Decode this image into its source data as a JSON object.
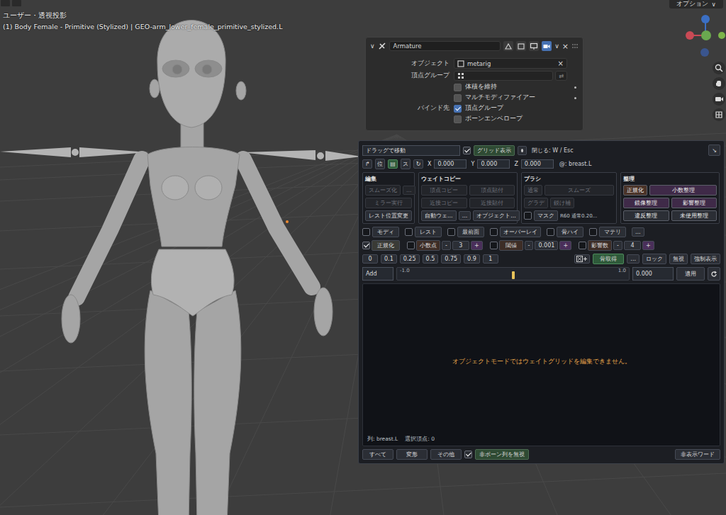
{
  "viewport": {
    "mode": "ユーザー・透視投影",
    "object": "(1) Body Female - Primitive (Stylized) | GEO-arm_lower_female_primitive_stylized.L",
    "options": "オプション",
    "options_arrow": "∨",
    "gizmo": [
      {
        "color": "#c94a55"
      },
      {
        "color": "#6aa84f"
      },
      {
        "color": "#7cb54a"
      },
      {
        "color": "#3b6fc4"
      },
      {
        "color": "#3a558e"
      }
    ]
  },
  "modifier": {
    "collapse": "∨",
    "name": "Armature",
    "toggles": [
      {
        "selected": false
      },
      {
        "selected": false
      },
      {
        "selected": false
      },
      {
        "selected": true
      }
    ],
    "dropdown": "∨",
    "close": "×",
    "object": {
      "label": "オブジェクト",
      "value": "metarig",
      "clear": "×"
    },
    "vgroup": {
      "label": "頂点グループ",
      "swap": "⇄"
    },
    "checks": [
      {
        "label": "体積を維持",
        "checked": false
      },
      {
        "label": "マルチモディファイアー",
        "checked": false
      }
    ],
    "bind_label": "バインド先",
    "bind": [
      {
        "label": "頂点グループ",
        "checked": true
      },
      {
        "label": "ボーンエンベロープ",
        "checked": false
      }
    ]
  },
  "weight": {
    "drag": "ドラッグで移動",
    "grid": {
      "label": "グリッド表示",
      "checked": true
    },
    "close_hint": "閉じる: W / Esc",
    "corner": "↘",
    "tools": [
      {
        "label": "↱",
        "selected": false
      },
      {
        "label": "位",
        "selected": false
      },
      {
        "label": "▤",
        "selected": true
      },
      {
        "label": "ス",
        "selected": false
      },
      {
        "label": "↻",
        "selected": false
      }
    ],
    "coords": [
      {
        "axis": "X",
        "value": "0.000"
      },
      {
        "axis": "Y",
        "value": "0.000"
      },
      {
        "axis": "Z",
        "value": "0.000"
      }
    ],
    "active": "@: breast.L",
    "groups": [
      {
        "title": "編集",
        "rows": [
          [
            {
              "label": "スムーズ化",
              "disabled": true
            },
            {
              "label": "...",
              "disabled": true
            }
          ],
          [
            {
              "label": "ミラー実行",
              "disabled": true
            }
          ],
          [
            {
              "label": "レスト位置変更",
              "disabled": false
            }
          ]
        ]
      },
      {
        "title": "ウェイトコピー",
        "rows": [
          [
            {
              "label": "頂点コピー",
              "disabled": true
            },
            {
              "label": "頂点貼付",
              "disabled": true
            }
          ],
          [
            {
              "label": "近接コピー",
              "disabled": true
            },
            {
              "label": "近接貼付",
              "disabled": true
            }
          ],
          [
            {
              "label": "自動ウェ...",
              "disabled": false
            },
            {
              "label": "...",
              "disabled": false
            },
            {
              "label": "オブジェクト...",
              "disabled": false
            }
          ]
        ]
      },
      {
        "title": "ブラシ",
        "rows": [
          [
            {
              "label": "通常",
              "disabled": true
            },
            {
              "label": "スムーズ",
              "disabled": true
            }
          ],
          [
            {
              "label": "グラデ",
              "disabled": true
            },
            {
              "label": "鋭け補",
              "disabled": true
            }
          ]
        ]
      },
      {
        "title": "整理",
        "rows": [
          [
            {
              "label": "正規化",
              "color": "#4a3328"
            },
            {
              "label": "小数整理",
              "color": "#3f2a48"
            }
          ],
          [
            {
              "label": "鏡像整理",
              "color": "#3f2a48"
            },
            {
              "label": "影響整理",
              "color": "#3f2a48"
            }
          ],
          [
            {
              "label": "違反整理",
              "color": "#2b2e35"
            },
            {
              "label": "未使用整理",
              "color": "#2b2e35"
            }
          ]
        ]
      }
    ],
    "mask": {
      "label": "マスク",
      "checked": false
    },
    "brush_info": "R60 通常0.20...",
    "toggles": [
      {
        "label": "モディ",
        "checked": false
      },
      {
        "label": "レスト",
        "checked": false
      },
      {
        "label": "最前面",
        "checked": false
      },
      {
        "label": "オーバーレイ",
        "checked": false
      },
      {
        "label": "骨ハイ",
        "checked": false
      },
      {
        "label": "マテリ",
        "checked": false
      }
    ],
    "toggles_more": "...",
    "options": [
      {
        "kind": "check",
        "label": "正規化",
        "checked": true
      },
      {
        "kind": "stepper",
        "label": "小数点",
        "checked": false,
        "minus": "-",
        "value": "3",
        "plus": "+"
      },
      {
        "kind": "stepper",
        "label": "閾値",
        "checked": false,
        "minus": "-",
        "value": "0.001",
        "plus": "+"
      },
      {
        "kind": "stepper",
        "label": "影響数",
        "checked": false,
        "minus": "-",
        "value": "4",
        "plus": "+"
      }
    ],
    "presets": [
      "0",
      "0.1",
      "0.25",
      "0.5",
      "0.75",
      "0.9",
      "1"
    ],
    "bone_buttons": [
      {
        "label": "骨取得",
        "selected": true
      },
      {
        "label": "...",
        "selected": false
      },
      {
        "label": "ロック",
        "selected": false
      },
      {
        "label": "無視",
        "selected": false
      },
      {
        "label": "強制表示",
        "selected": false
      }
    ],
    "slider": {
      "mode": "Add",
      "min": "-1.0",
      "max": "1.0",
      "level": 0.5,
      "value": "0.000",
      "apply": "適用"
    },
    "message": "オブジェクトモードではウェイトグリッドを編集できません。",
    "status": {
      "column": "列: breast.L",
      "selected": "選択頂点: 0"
    },
    "filters": [
      "すべて",
      "変形",
      "その他"
    ],
    "ignore": {
      "label": "非ボーン列を無視",
      "checked": true
    },
    "hidden_words": "非表示ワード"
  }
}
